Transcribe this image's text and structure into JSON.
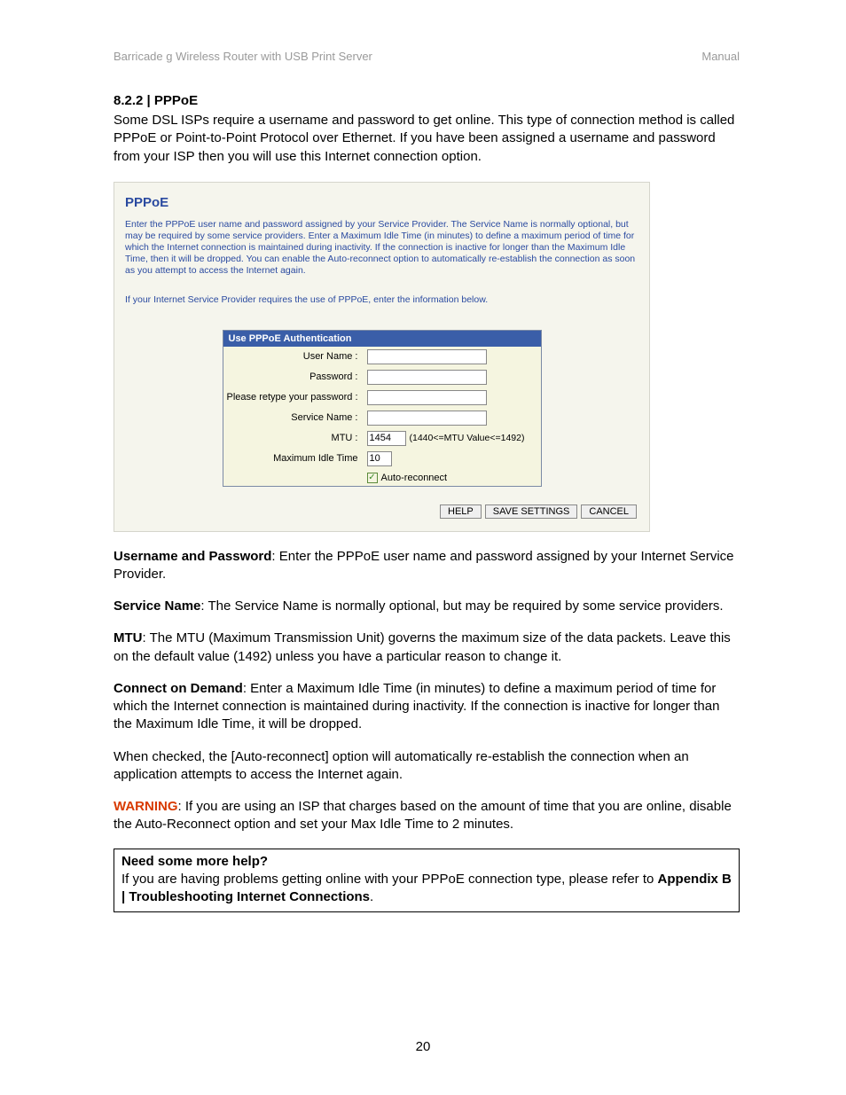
{
  "header": {
    "left": "Barricade g Wireless Router with USB Print Server",
    "right": "Manual"
  },
  "section": {
    "number": "8.2.2 | PPPoE"
  },
  "intro": "Some DSL ISPs require a username and password to get online.  This type of connection method is called PPPoE or Point-to-Point Protocol over Ethernet. If you have been assigned a username and password from your ISP then you will use this Internet connection option.",
  "pppoe": {
    "title": "PPPoE",
    "desc1": "Enter the PPPoE user name and password assigned by your Service Provider. The Service Name is normally optional, but may be required by some service providers.  Enter a Maximum Idle Time (in minutes) to define a maximum period of time for which the Internet connection is maintained during inactivity.  If the connection is inactive for longer than the Maximum Idle Time, then it will be dropped.  You can enable the Auto-reconnect option to automatically re-establish the connection as soon as you attempt to access the Internet again.",
    "desc2": "If your Internet Service Provider requires the use of PPPoE, enter the information below.",
    "form_header": "Use PPPoE Authentication",
    "rows": {
      "username_label": "User Name :",
      "username_value": "",
      "password_label": "Password :",
      "password_value": "",
      "retype_label": "Please retype your password :",
      "retype_value": "",
      "service_label": "Service Name :",
      "service_value": "",
      "mtu_label": "MTU :",
      "mtu_value": "1454",
      "mtu_hint": "(1440<=MTU Value<=1492)",
      "idle_label": "Maximum Idle Time",
      "idle_value": "10",
      "autoreconnect_label": "Auto-reconnect",
      "autoreconnect_checked": true
    },
    "buttons": {
      "help": "HELP",
      "save": "SAVE SETTINGS",
      "cancel": "CANCEL"
    }
  },
  "definitions": {
    "userpass_label": "Username and Password",
    "userpass_text": ": Enter the PPPoE user name and password assigned by your Internet Service Provider.",
    "service_label": "Service Name",
    "service_text": ": The Service Name is normally optional, but may be required by some service providers.",
    "mtu_label": "MTU",
    "mtu_text": ": The MTU (Maximum Transmission Unit) governs the maximum size of the data packets. Leave this on the default value (1492) unless you have a particular reason to change it.",
    "connect_label": "Connect on Demand",
    "connect_text": ": Enter a Maximum Idle Time (in minutes) to define a maximum period of time for which the Internet connection is maintained during inactivity. If the connection is inactive for longer than the Maximum Idle Time, it will be dropped.",
    "autoreconnect_text": "When checked, the [Auto-reconnect] option will automatically re-establish the connection when an application attempts to access the Internet again.",
    "warning_label": "WARNING",
    "warning_text": ": If you are using an ISP that charges based on the amount of time that you are online, disable the Auto-Reconnect option and set your Max Idle Time to 2 minutes."
  },
  "helpbox": {
    "title": "Need some more help?",
    "text": "If you are having problems getting online with your PPPoE connection type, please refer to ",
    "ref": "Appendix B | Troubleshooting Internet Connections",
    "period": "."
  },
  "page_number": "20"
}
